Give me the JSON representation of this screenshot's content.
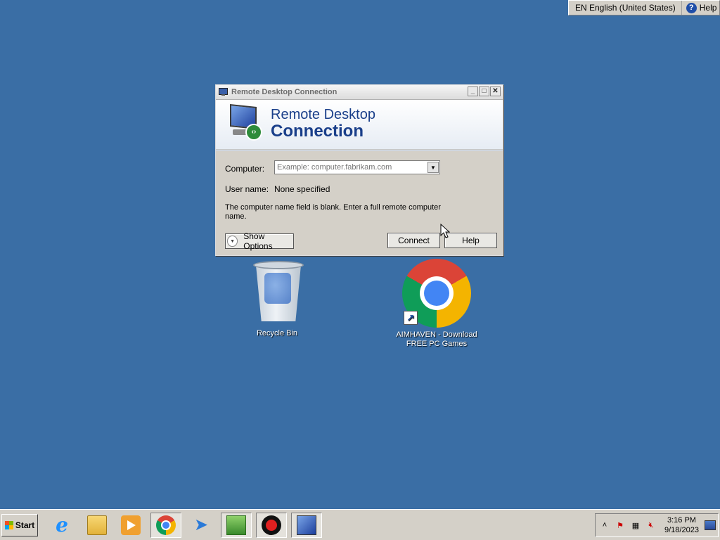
{
  "language_bar": {
    "language": "EN English (United States)",
    "help_label": "Help"
  },
  "window": {
    "title": "Remote Desktop Connection",
    "banner_line1": "Remote Desktop",
    "banner_line2": "Connection",
    "computer_label": "Computer:",
    "computer_placeholder": "Example: computer.fabrikam.com",
    "computer_value": "",
    "username_label": "User name:",
    "username_value": "None specified",
    "message": "The computer name field is blank. Enter a full remote computer name.",
    "show_options_label": "Show Options",
    "connect_label": "Connect",
    "help_label": "Help"
  },
  "desktop": {
    "icons": [
      {
        "label": "Recycle Bin",
        "icon": "recycle-bin-icon"
      },
      {
        "label": "AIMHAVEN - Download FREE PC Games",
        "icon": "chrome-shortcut-icon"
      }
    ]
  },
  "taskbar": {
    "start_label": "Start",
    "apps": [
      {
        "name": "internet-explorer",
        "icon": "internet-explorer-icon"
      },
      {
        "name": "file-explorer",
        "icon": "folder-icon"
      },
      {
        "name": "media-player",
        "icon": "media-player-icon"
      },
      {
        "name": "chrome",
        "icon": "chrome-icon"
      },
      {
        "name": "paper-plane-app",
        "icon": "paper-plane-icon"
      },
      {
        "name": "download-app",
        "icon": "download-icon"
      },
      {
        "name": "recorder",
        "icon": "record-icon"
      },
      {
        "name": "remote-desktop",
        "icon": "remote-desktop-icon"
      }
    ],
    "time": "3:16 PM",
    "date": "9/18/2023"
  },
  "colors": {
    "desktop_background": "#3a6ea5",
    "window_face": "#d4d0c8",
    "banner_text": "#1a3f8a"
  }
}
